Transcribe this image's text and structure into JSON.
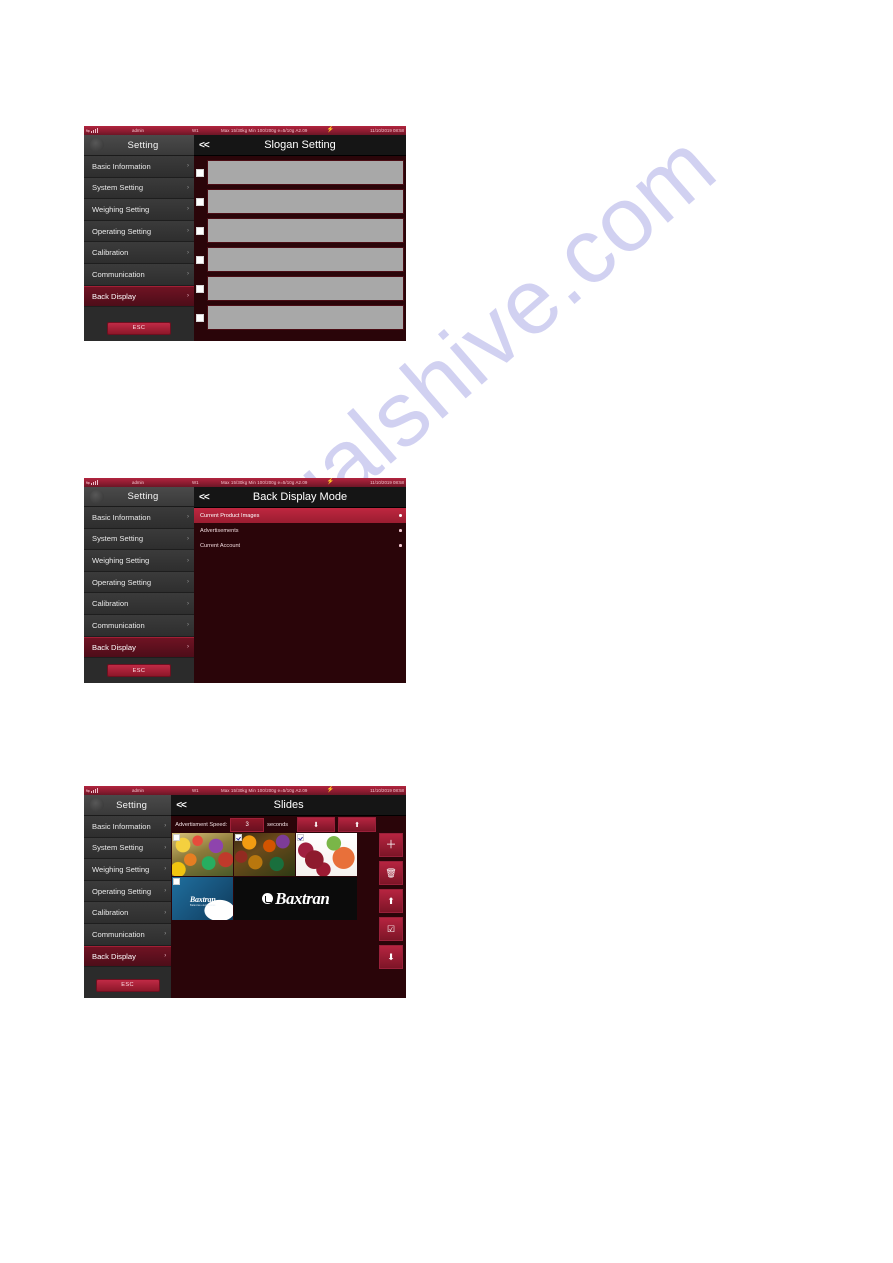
{
  "page": {
    "watermark": "manualshive.com",
    "background": "#ffffff"
  },
  "colors": {
    "accent_red": "#b2243e",
    "panel_dark_red": "#2a0509",
    "sidebar_gray": "#2e2e2e",
    "header_black": "#151515",
    "field_gray": "#a8a8a8",
    "watermark": "#c9c9ef"
  },
  "status_bar": {
    "user": "admin",
    "channel": "W1",
    "spec": "Max 15/30kg  Min 100/200g e=5/10g A2.09",
    "datetime": "11/10/2019 08:58",
    "signal_icon": "signal-bars-icon",
    "power_icon": "power-bolt-icon"
  },
  "sidebar": {
    "title": "Setting",
    "avatar_icon": "user-avatar-icon",
    "items": [
      {
        "label": "Basic Information",
        "chevron": "›",
        "active": false
      },
      {
        "label": "System Setting",
        "chevron": "›",
        "active": false
      },
      {
        "label": "Weighing Setting",
        "chevron": "›",
        "active": false
      },
      {
        "label": "Operating Setting",
        "chevron": "›",
        "active": false
      },
      {
        "label": "Calibration",
        "chevron": "›",
        "active": false
      },
      {
        "label": "Communication",
        "chevron": "›",
        "active": false
      },
      {
        "label": "Back Display",
        "chevron": "›",
        "active": true
      }
    ],
    "esc_label": "ESC"
  },
  "screens": [
    {
      "id": "slogan-setting",
      "title": "Slogan Setting",
      "back_label": "<<",
      "rows": [
        {
          "checked": false,
          "value": ""
        },
        {
          "checked": false,
          "value": ""
        },
        {
          "checked": false,
          "value": ""
        },
        {
          "checked": false,
          "value": ""
        },
        {
          "checked": false,
          "value": ""
        },
        {
          "checked": false,
          "value": ""
        }
      ]
    },
    {
      "id": "back-display-mode",
      "title": "Back Display Mode",
      "back_label": "<<",
      "options": [
        {
          "label": "Current Product Images",
          "selected": true
        },
        {
          "label": "Advertisements",
          "selected": false
        },
        {
          "label": "Current Account",
          "selected": false
        }
      ]
    },
    {
      "id": "slides",
      "title": "Slides",
      "back_label": "<<",
      "speed": {
        "label": "Advertisment Speed:",
        "value": "3",
        "unit": "seconds",
        "down_icon": "arrow-down-icon",
        "up_icon": "arrow-up-icon"
      },
      "thumbnails": [
        {
          "name": "vegetables-basket-image",
          "checked": false
        },
        {
          "name": "market-produce-image",
          "checked": true
        },
        {
          "name": "grapes-citrus-kiwi-image",
          "checked": true
        },
        {
          "name": "baxtran-blue-logo-image",
          "checked": false
        },
        {
          "name": "baxtran-wordmark-image",
          "checked": false
        }
      ],
      "tools": [
        {
          "name": "add-slide-button",
          "glyph": "＋"
        },
        {
          "name": "delete-slide-button",
          "glyph": "🗑"
        },
        {
          "name": "move-up-button",
          "glyph": "⬆"
        },
        {
          "name": "select-all-button",
          "glyph": "☑"
        },
        {
          "name": "move-down-button",
          "glyph": "⬇"
        }
      ],
      "brand_text": "Baxtran",
      "brand_sub": "Balanzas electronicas"
    }
  ]
}
